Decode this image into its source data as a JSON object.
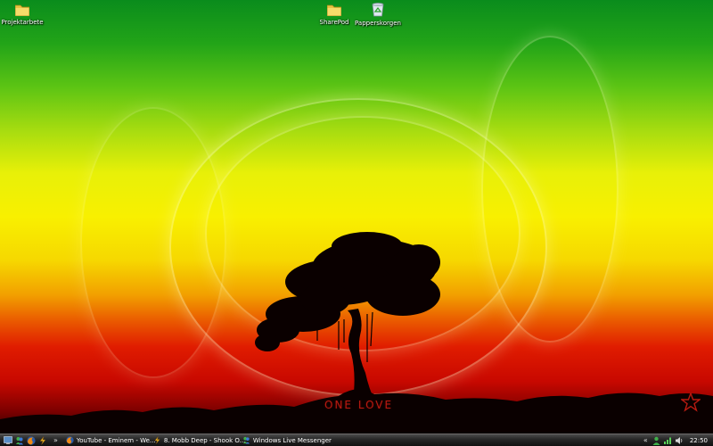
{
  "desktop": {
    "icons": [
      {
        "label": "Projektarbete",
        "icon": "folder-icon"
      },
      {
        "label": "SharePod",
        "icon": "folder-icon"
      },
      {
        "label": "Papperskorgen",
        "icon": "recycle-bin-icon"
      }
    ],
    "wallpaper": {
      "text": "ONE LOVE",
      "colors": {
        "green": "#0a8c1c",
        "yellow": "#f8f000",
        "red": "#e01c00"
      }
    }
  },
  "taskbar": {
    "quick_launch": [
      {
        "icon": "show-desktop-icon"
      },
      {
        "icon": "messenger-icon"
      },
      {
        "icon": "firefox-icon"
      },
      {
        "icon": "winamp-icon"
      }
    ],
    "overflow_chevron": "»",
    "tasks": [
      {
        "label": "YouTube - Eminem - We...",
        "icon": "firefox-icon"
      },
      {
        "label": "8. Mobb Deep - Shook O...",
        "icon": "winamp-icon"
      },
      {
        "label": "Windows Live Messenger",
        "icon": "messenger-icon"
      }
    ],
    "tray": {
      "expand": "«",
      "icons": [
        "messenger-status-icon",
        "network-icon",
        "volume-icon"
      ],
      "clock": "22:50"
    }
  }
}
